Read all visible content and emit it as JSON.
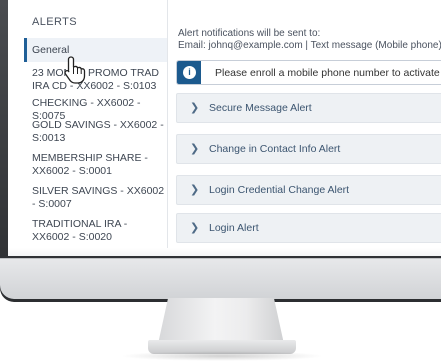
{
  "sidebar": {
    "title": "ALERTS",
    "items": [
      {
        "label": "General"
      },
      {
        "label": "23 MONTH PROMO TRAD IRA CD - XX6002 - S:0103"
      },
      {
        "label": "CHECKING - XX6002 - S:0075"
      },
      {
        "label": "GOLD SAVINGS - XX6002 - S:0013"
      },
      {
        "label": "MEMBERSHIP SHARE - XX6002 - S:0001"
      },
      {
        "label": "SILVER SAVINGS - XX6002 - S:0007"
      },
      {
        "label": "TRADITIONAL IRA - XX6002 - S:0020"
      }
    ]
  },
  "main": {
    "notice_line1": "Alert notifications will be sent to:",
    "notice_line2": "Email: johnq@example.com | Text message (Mobile phone)",
    "info_icon": "i",
    "info_text": "Please enroll a mobile phone number to activate",
    "alerts": [
      {
        "label": "Secure Message Alert"
      },
      {
        "label": "Change in Contact Info Alert"
      },
      {
        "label": "Login Credential Change Alert"
      },
      {
        "label": "Login Alert"
      }
    ]
  },
  "colors": {
    "accent": "#1c5a8e",
    "accordion_bg": "#eef1f4",
    "bezel": "#3a3c40"
  },
  "icons": {
    "info": "info-icon",
    "chevron": "chevron-right-icon",
    "cursor": "hand-cursor-icon"
  }
}
